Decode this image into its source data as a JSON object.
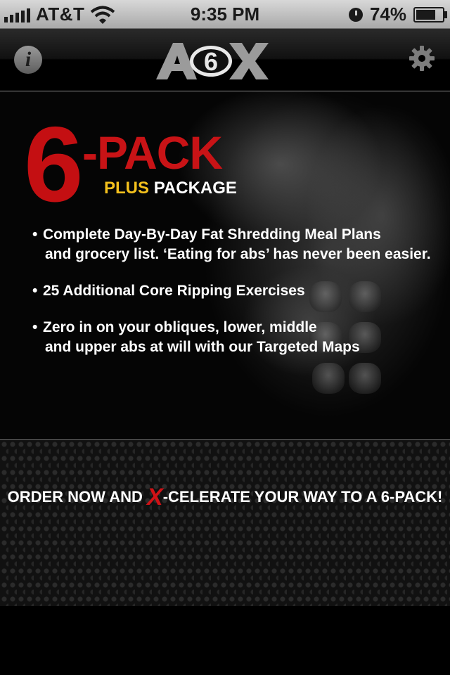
{
  "status_bar": {
    "carrier": "AT&T",
    "time": "9:35 PM",
    "battery": "74%",
    "battery_level": 0.74
  },
  "nav": {
    "logo_icon": "a6x-logo",
    "info_icon": "info-icon",
    "info_glyph": "i",
    "settings_icon": "gear-icon"
  },
  "hero": {
    "title_number": "6",
    "title_word": "-PACK",
    "subtitle_plus": "PLUS",
    "subtitle_package": "PACKAGE",
    "bullets": [
      {
        "line1": "Complete Day-By-Day Fat Shredding Meal Plans",
        "line2": "and grocery list. ‘Eating for abs’ has never been easier."
      },
      {
        "line1": "25 Additional Core Ripping Exercises",
        "line2": ""
      },
      {
        "line1": "Zero in on your obliques, lower, middle",
        "line2": "and upper abs at will with our Targeted Maps"
      }
    ]
  },
  "order": {
    "before": "ORDER NOW AND ",
    "x": "X",
    "after": "-CELERATE YOUR WAY TO A 6-PACK!"
  },
  "colors": {
    "accent_red": "#c40f12",
    "accent_yellow": "#f4c11d"
  }
}
